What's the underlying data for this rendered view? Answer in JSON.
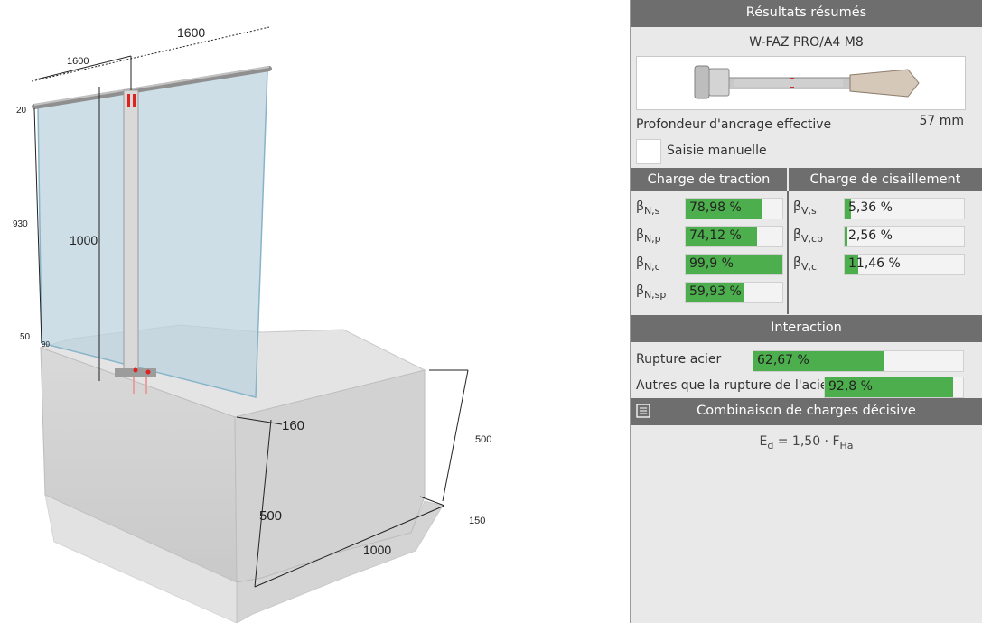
{
  "drawing": {
    "dim_rail_top": "1600",
    "dim_rail_left": "1600",
    "dim_left_top": "20",
    "dim_left_height": "930",
    "dim_left_bottom": "50",
    "dim_left_bottom_small": "90",
    "dim_post_height": "1000",
    "dim_edge": "160",
    "dim_block_height_front": "500",
    "dim_block_height_right": "500",
    "dim_right_small": "150",
    "dim_block_length": "1000"
  },
  "panel": {
    "summary_title": "Résultats résumés",
    "product_name": "W-FAZ PRO/A4 M8",
    "embedment_label": "Profondeur d'ancrage effective",
    "embedment_value": "57 mm",
    "manual_label": "Saisie manuelle",
    "tension_title": "Charge de traction",
    "shear_title": "Charge de cisaillement",
    "tension": [
      {
        "sym": "β",
        "sub": "N,s",
        "label": "78,98 %",
        "value": 78.98
      },
      {
        "sym": "β",
        "sub": "N,p",
        "label": "74,12 %",
        "value": 74.12
      },
      {
        "sym": "β",
        "sub": "N,c",
        "label": "99,9 %",
        "value": 99.9
      },
      {
        "sym": "β",
        "sub": "N,sp",
        "label": "59,93 %",
        "value": 59.93
      }
    ],
    "shear": [
      {
        "sym": "β",
        "sub": "V,s",
        "label": "5,36 %",
        "value": 5.36
      },
      {
        "sym": "β",
        "sub": "V,cp",
        "label": "2,56 %",
        "value": 2.56
      },
      {
        "sym": "β",
        "sub": "V,c",
        "label": "11,46 %",
        "value": 11.46
      }
    ],
    "interaction_title": "Interaction",
    "interaction": [
      {
        "label": "Rupture acier",
        "value_label": "62,67 %",
        "value": 62.67
      },
      {
        "label": "Autres que la rupture de l'acier",
        "value_label": "92,8 %",
        "value": 92.8
      }
    ],
    "combination_title": "Combinaison de charges décisive",
    "combination_icon": "list-icon",
    "formula_main": "E",
    "formula_sub": "d",
    "formula_mid": " = 1,50 · F",
    "formula_sub2": "Ha"
  },
  "colors": {
    "header": "#6e6e6e",
    "bar_fill": "#4cae4c",
    "panel_bg": "#e9e9e9",
    "glass": "#bcd3df"
  }
}
